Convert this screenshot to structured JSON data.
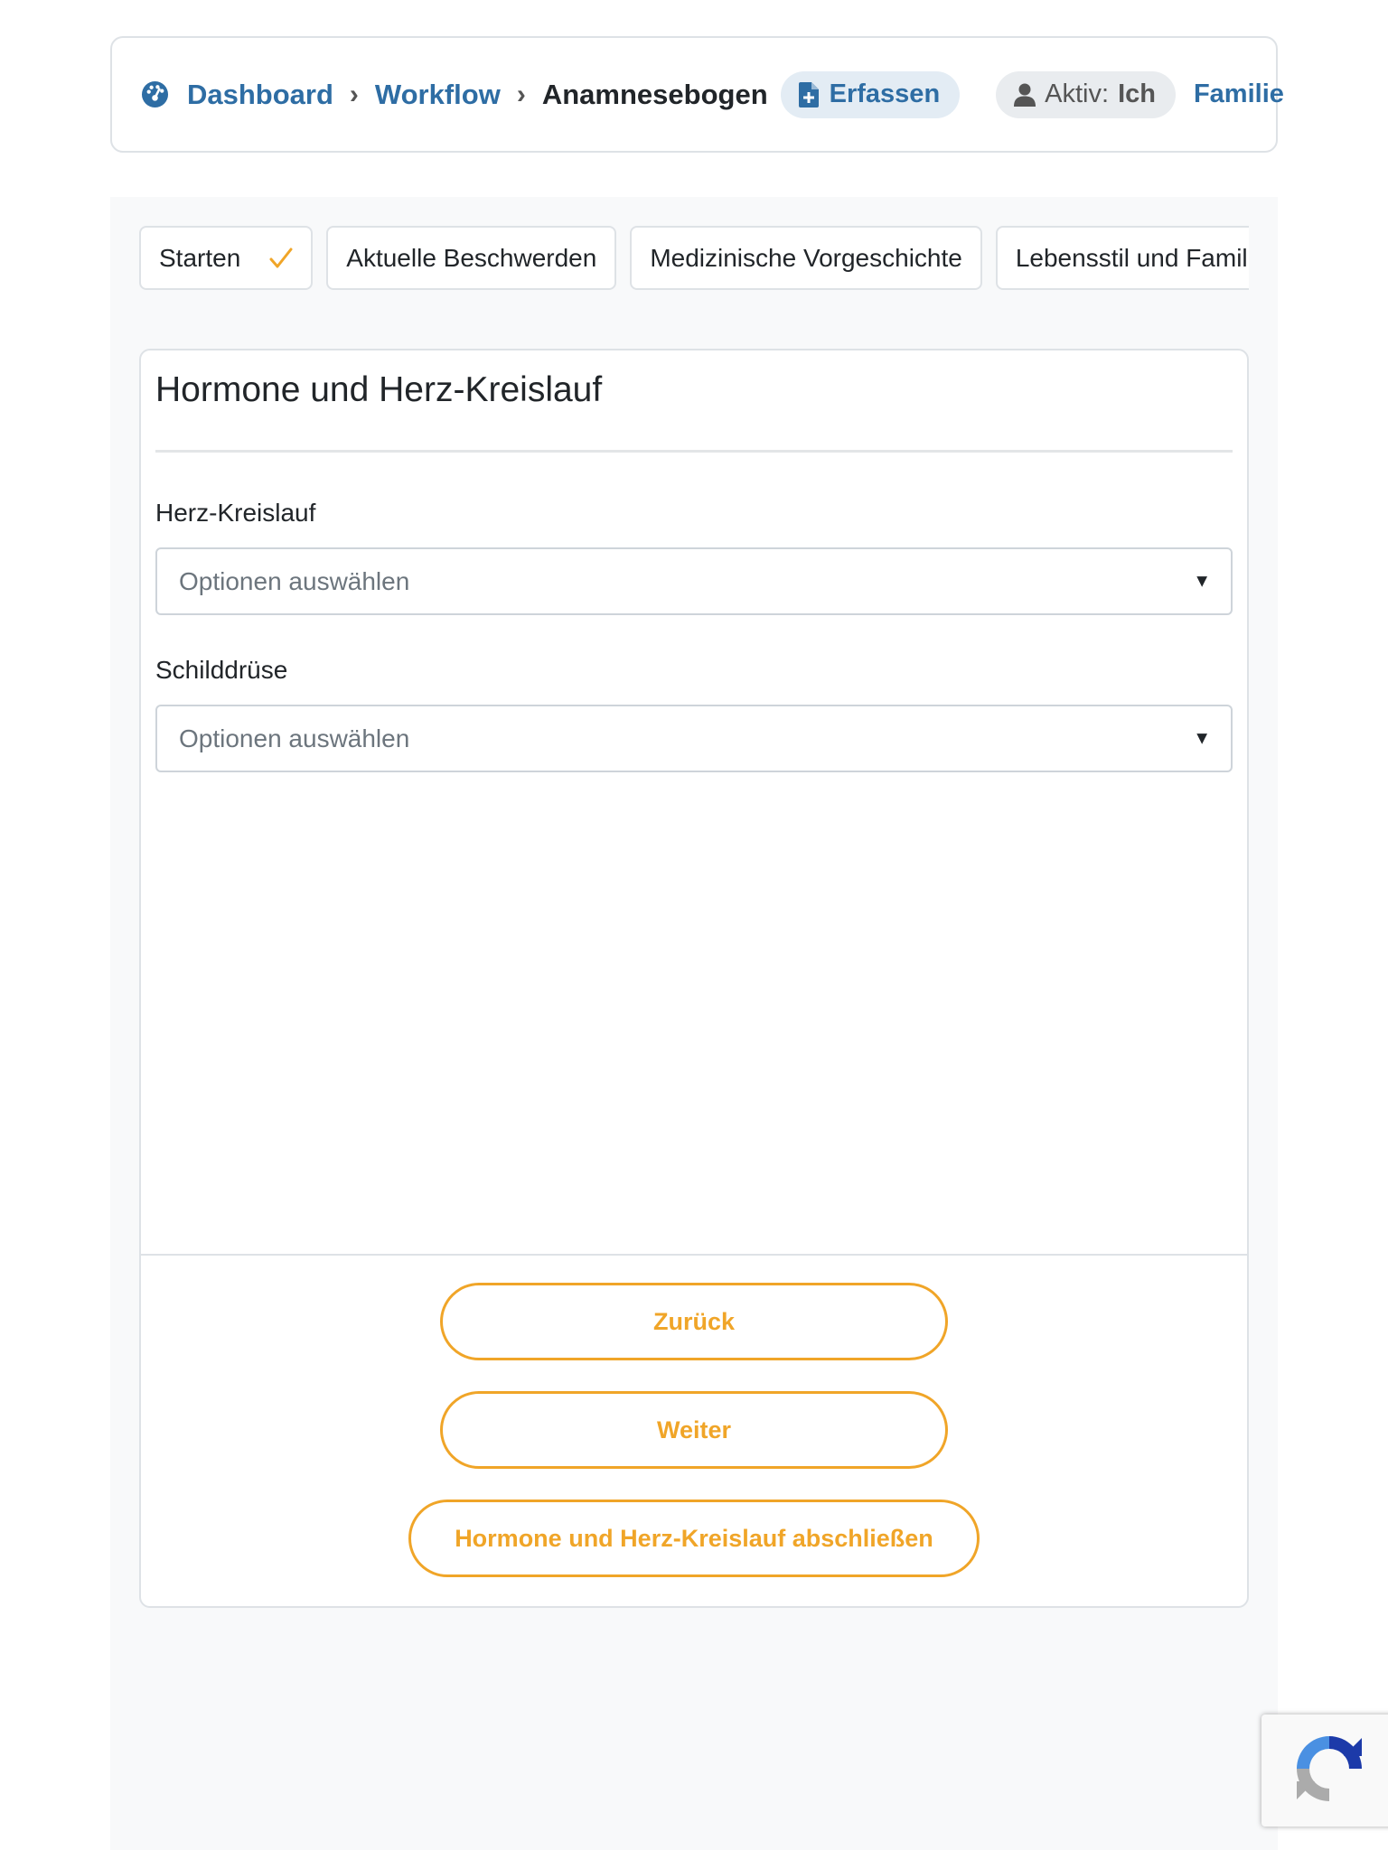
{
  "breadcrumb": {
    "icon": "dashboard-gauge-icon",
    "items": [
      {
        "label": "Dashboard"
      },
      {
        "label": "Workflow"
      }
    ],
    "separator": "›",
    "current": "Anamnesebogen"
  },
  "header": {
    "erfassen_label": "Erfassen",
    "erfassen_icon": "file-add-icon",
    "aktiv_label": "Aktiv:",
    "aktiv_value": "Ich",
    "aktiv_icon": "user-icon",
    "familie_label": "Familie"
  },
  "tabs": [
    {
      "label": "Starten",
      "completed": true
    },
    {
      "label": "Aktuelle Beschwerden",
      "completed": false
    },
    {
      "label": "Medizinische Vorgeschichte",
      "completed": false
    },
    {
      "label": "Lebensstil und Familie",
      "completed": false
    }
  ],
  "form": {
    "title": "Hormone und Herz-Kreislauf",
    "fields": [
      {
        "label": "Herz-Kreislauf",
        "placeholder": "Optionen auswählen"
      },
      {
        "label": "Schilddrüse",
        "placeholder": "Optionen auswählen"
      }
    ]
  },
  "buttons": {
    "back_label": "Zurück",
    "next_label": "Weiter",
    "finish_label": "Hormone und Herz-Kreislauf abschließen"
  },
  "colors": {
    "link": "#2e6da4",
    "accent": "#f0a528",
    "pill_bg": "#e3ecf4",
    "panel_bg": "#f8f9fa"
  }
}
